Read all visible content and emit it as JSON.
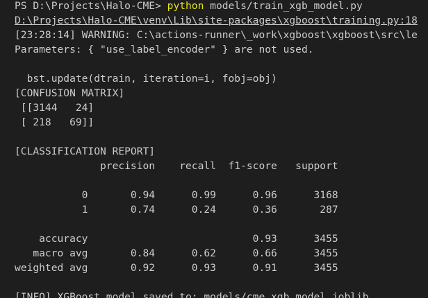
{
  "terminal": {
    "prompt": "PS D:\\Projects\\Halo-CME> ",
    "command": "python",
    "command_args": " models/train_xgb_model.py",
    "warning_path": "D:\\Projects\\Halo-CME\\venv\\Lib\\site-packages\\xgboost\\training.py:18",
    "warning_line": "[23:28:14] WARNING: C:\\actions-runner\\_work\\xgboost\\xgboost\\src\\le",
    "params_line": "Parameters: { \"use_label_encoder\" } are not used.",
    "blank1": "",
    "update_line": "  bst.update(dtrain, iteration=i, fobj=obj)",
    "cm_header": "[CONFUSION MATRIX]",
    "cm_row1": " [[3144   24]",
    "cm_row2": " [ 218   69]]",
    "blank2": "",
    "cr_header": "[CLASSIFICATION REPORT]",
    "cr_columns": "              precision    recall  f1-score   support",
    "blank3": "",
    "cr_row0": "           0       0.94      0.99      0.96      3168",
    "cr_row1": "           1       0.74      0.24      0.36       287",
    "blank4": "",
    "cr_accuracy": "    accuracy                           0.93      3455",
    "cr_macro": "   macro avg       0.84      0.62      0.66      3455",
    "cr_weighted": "weighted avg       0.92      0.93      0.91      3455",
    "blank5": "",
    "info_line": "[INFO] XGBoost model saved to: models/cme_xgb_model.joblib"
  },
  "colors": {
    "background": "#1e1e1e",
    "text": "#cccccc",
    "command": "#e5e510"
  }
}
